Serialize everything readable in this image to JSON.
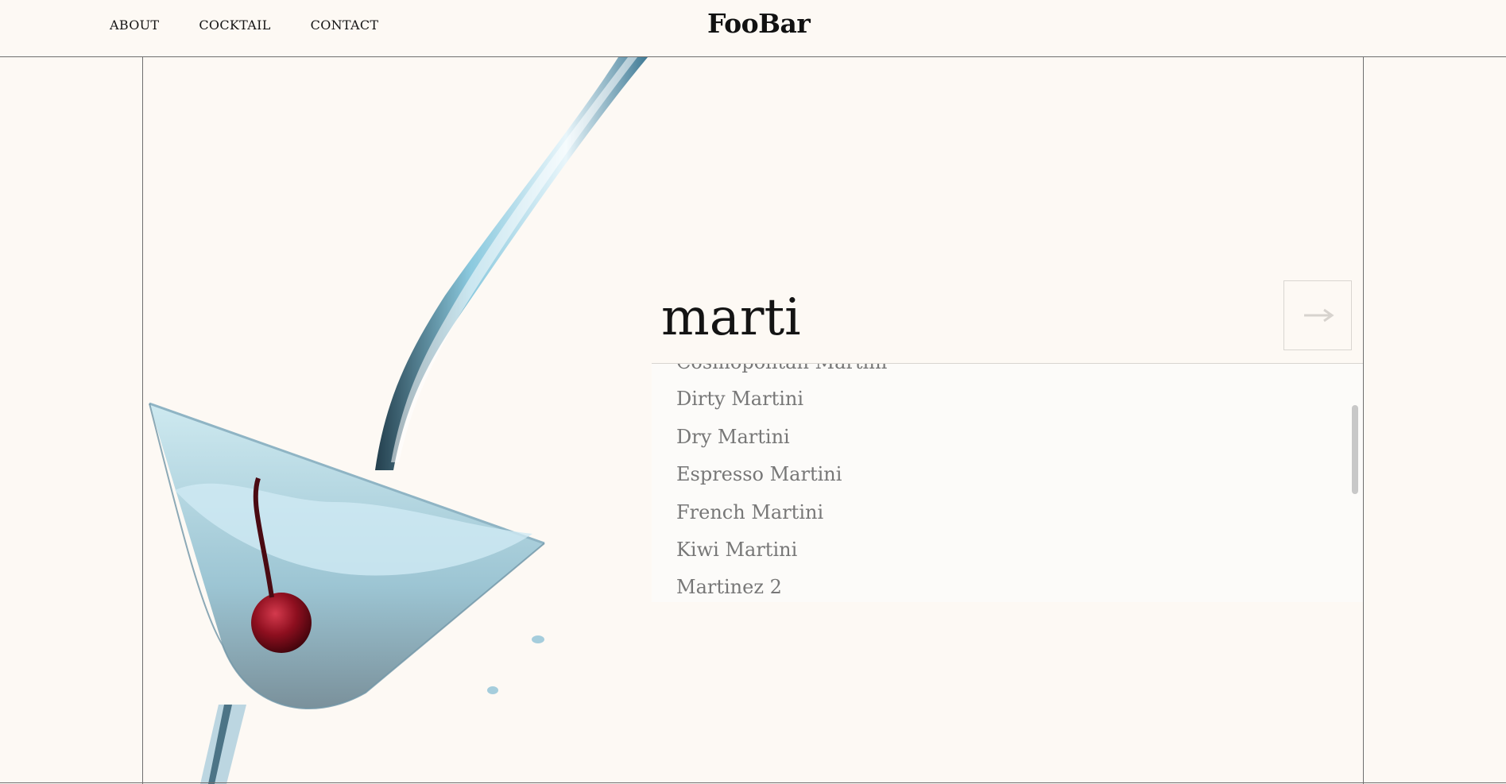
{
  "header": {
    "nav": [
      "ABOUT",
      "COCKTAIL",
      "CONTACT"
    ],
    "logo": "FooBar"
  },
  "search": {
    "value": "marti",
    "go_icon": "arrow-right-icon"
  },
  "suggestions": [
    "Cosmopolitan Martini",
    "Dirty Martini",
    "Dry Martini",
    "Espresso Martini",
    "French Martini",
    "Kiwi Martini",
    "Martinez 2"
  ],
  "colors": {
    "background": "#fdf9f4",
    "text": "#141414",
    "suggestion_text": "#777777",
    "cherry": "#8e0f1f",
    "liquid": "#7ec4dc"
  }
}
